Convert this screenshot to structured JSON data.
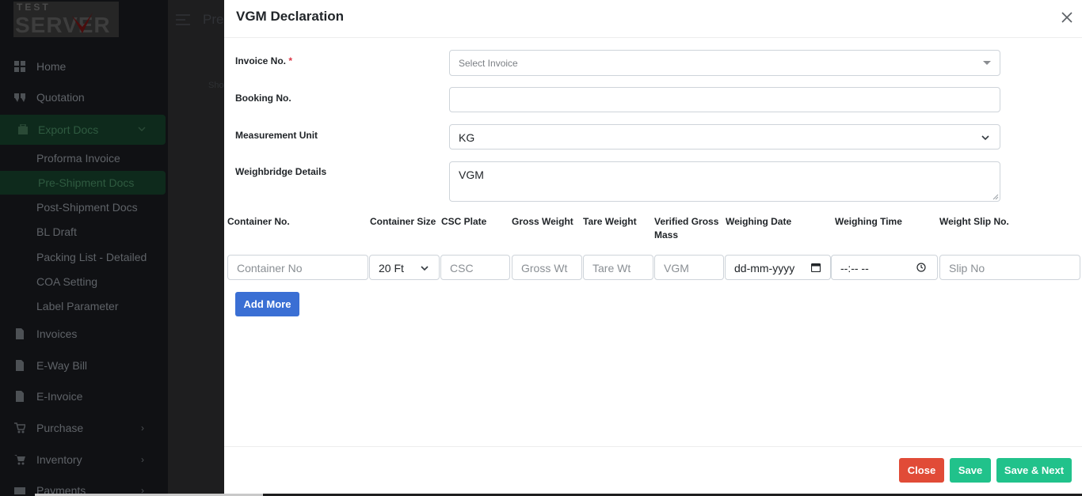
{
  "sidebar": {
    "logo": {
      "top_text": "TEST",
      "main_text": "SERVER"
    },
    "items": [
      {
        "label": "Home",
        "icon": "dashboard-icon"
      },
      {
        "label": "Quotation",
        "icon": "quote-icon"
      },
      {
        "label": "Export Docs",
        "icon": "briefcase-icon",
        "active": true
      },
      {
        "label": "Invoices",
        "icon": "file-icon"
      },
      {
        "label": "E-Way Bill",
        "icon": "file-icon"
      },
      {
        "label": "E-Invoice",
        "icon": "file-icon"
      },
      {
        "label": "Purchase",
        "icon": "cart-plus-icon"
      },
      {
        "label": "Inventory",
        "icon": "cart-icon"
      },
      {
        "label": "Payments",
        "icon": "payment-icon"
      }
    ],
    "export_sub": [
      "Proforma Invoice",
      "Pre-Shipment Docs",
      "Post-Shipment Docs",
      "BL Draft",
      "Packing List - Detailed",
      "COA Setting",
      "Label Parameter"
    ],
    "chevron": "›"
  },
  "background": {
    "title": "Pre",
    "small": "Sho"
  },
  "modal": {
    "title": "VGM Declaration",
    "fields": {
      "invoice_label": "Invoice No.",
      "invoice_required": "*",
      "invoice_placeholder": "Select Invoice",
      "booking_label": "Booking No.",
      "booking_value": "",
      "unit_label": "Measurement Unit",
      "unit_value": "KG",
      "weighbridge_label": "Weighbridge Details",
      "weighbridge_value": "VGM"
    },
    "columns": [
      "Container No.",
      "Container Size",
      "CSC Plate",
      "Gross Weight",
      "Tare Weight",
      "Verified Gross Mass",
      "Weighing Date",
      "Weighing Time",
      "Weight Slip No."
    ],
    "row": {
      "container_no_placeholder": "Container No",
      "container_size": "20 Ft",
      "csc_placeholder": "CSC",
      "gross_placeholder": "Gross Wt",
      "tare_placeholder": "Tare Wt",
      "vgm_placeholder": "VGM",
      "date_placeholder": "dd-mm-yyyy",
      "time_placeholder": "--:-- --",
      "slip_placeholder": "Slip No"
    },
    "buttons": {
      "add_more": "Add More",
      "close": "Close",
      "save": "Save",
      "save_next": "Save & Next"
    }
  }
}
